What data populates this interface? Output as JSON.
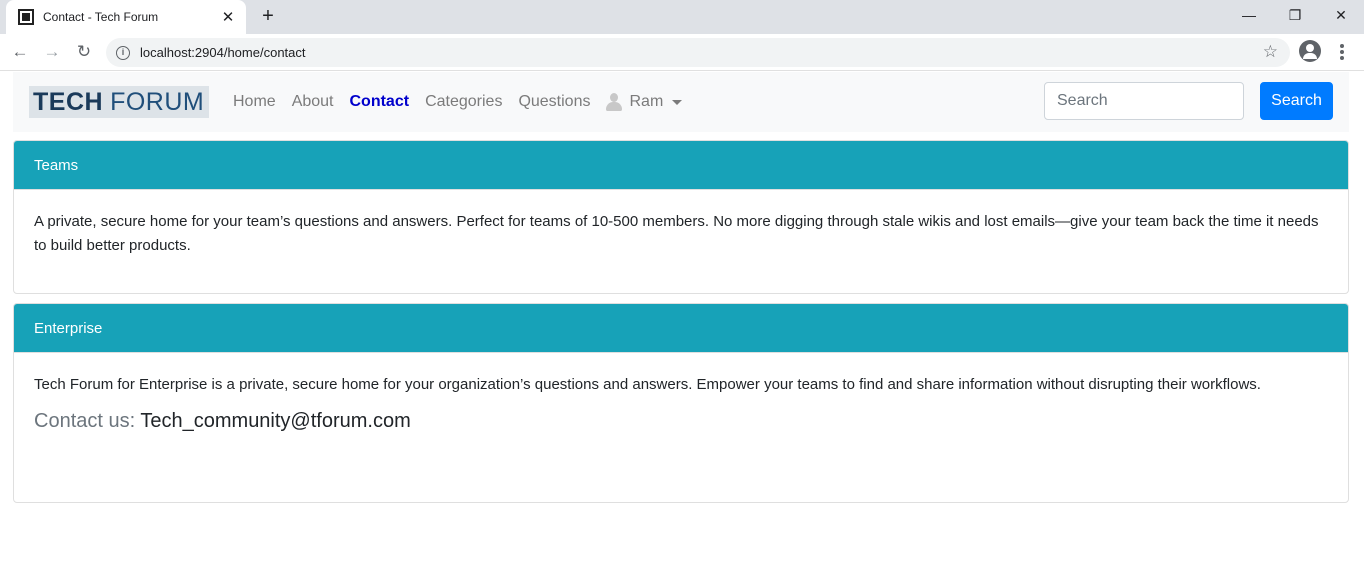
{
  "browser": {
    "tab_title": "Contact - Tech Forum",
    "tab_close": "✕",
    "new_tab": "+",
    "url": "localhost:2904/home/contact",
    "window_controls": {
      "minimize": "—",
      "restore": "❐",
      "close": "✕"
    },
    "nav_icons": {
      "back": "←",
      "forward": "→",
      "reload": "↻",
      "info": "i",
      "star": "☆"
    }
  },
  "site": {
    "brand_tech": "TECH",
    "brand_forum": "FORUM",
    "nav": {
      "home": "Home",
      "about": "About",
      "contact": "Contact",
      "categories": "Categories",
      "questions": "Questions",
      "user": "Ram"
    },
    "search": {
      "placeholder": "Search",
      "button": "Search"
    }
  },
  "cards": {
    "teams": {
      "header": "Teams",
      "body": "A private, secure home for your team’s questions and answers. Perfect for teams of 10-500 members. No more digging through stale wikis and lost emails—give your team back the time it needs to build better products."
    },
    "enterprise": {
      "header": "Enterprise",
      "body": "Tech Forum for Enterprise is a private, secure home for your organization’s questions and answers. Empower your teams to find and share information without disrupting their workflows.",
      "contact_label": "Contact us:",
      "contact_email": "Tech_community@tforum.com"
    }
  },
  "colors": {
    "card_header": "#17a2b8",
    "primary_button": "#007bff",
    "active_nav": "#0000cc"
  }
}
